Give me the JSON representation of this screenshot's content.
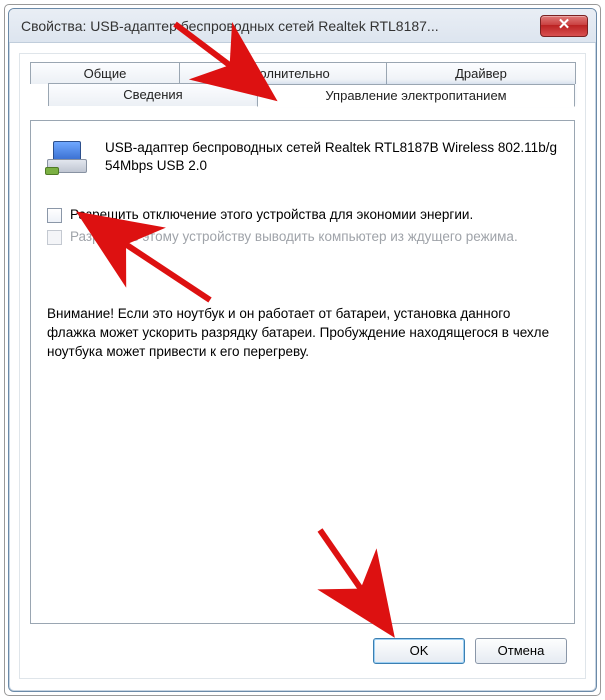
{
  "window": {
    "title": "Свойства: USB-адаптер беспроводных сетей Realtek RTL8187..."
  },
  "tabs": {
    "general": "Общие",
    "advanced": "Дополнительно",
    "driver": "Драйвер",
    "details": "Сведения",
    "power": "Управление электропитанием"
  },
  "device": {
    "name": "USB-адаптер беспроводных сетей Realtek RTL8187B Wireless 802.11b/g 54Mbps USB 2.0"
  },
  "checkboxes": {
    "allow_off": "Разрешить отключение этого устройства для экономии энергии.",
    "allow_wake": "Разрешить этому устройству выводить компьютер из ждущего режима."
  },
  "warning": "Внимание! Если это ноутбук и он работает от батареи, установка данного флажка может ускорить разрядку батареи. Пробуждение находящегося в чехле ноутбука может привести к его перегреву.",
  "buttons": {
    "ok": "OK",
    "cancel": "Отмена"
  },
  "annotation_color": "#d11"
}
